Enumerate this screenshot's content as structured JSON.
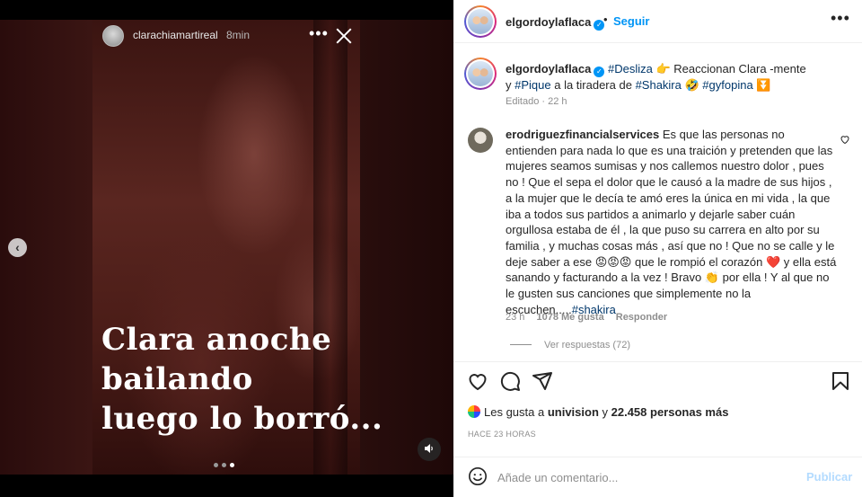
{
  "story": {
    "username": "clarachiamartireal",
    "time": "8min",
    "more_label": "•••",
    "caption_lines": [
      "Clara anoche",
      "bailando",
      "luego lo borró..."
    ],
    "dots_total": 3,
    "dots_active_index": 2
  },
  "post": {
    "account": "elgordoylaflaca",
    "follow_label": "Seguir",
    "header_sep": "•",
    "more_label": "•••",
    "caption": {
      "tag1": "#Desliza",
      "emoji1": "👉",
      "text1": " Reaccionan Clara -mente y ",
      "tag2": "#Pique",
      "text2": " a la tiradera de ",
      "tag3": "#Shakira",
      "emoji2": " 🤣 ",
      "tag4": "#gyfopina",
      "emoji3": " ⏬"
    },
    "caption_meta": "Editado · 22 h"
  },
  "comment": {
    "username": "erodriguezfinancialservices",
    "text_before_emojis": "Es que las personas no entienden para nada lo que es una traición y pretenden que las mujeres seamos sumisas y nos callemos nuestro dolor , pues no ! Que el sepa el dolor que le causó a la madre de sus hijos , a la mujer que le decía te amó eres la única en mi vida , la que iba a todos sus partidos a animarlo y dejarle saber cuán orgullosa estaba de él , la que puso su carrera en alto por su familia , y muchas cosas más , así que no ! Que no se calle y le deje saber a ese ",
    "emojis_angry": "😡😡😡",
    "text_mid": " que le rompió el corazón ",
    "emoji_heart": "❤️",
    "text_mid2": " y ella está sanando y facturando a la vez ! Bravo ",
    "emoji_clap": "👏",
    "text_end": " por ella ! Y al que no le gusten sus canciones que simplemente no la escuchen.....",
    "tag": "#shakira",
    "time": "23 h",
    "likes": "1078 Me gusta",
    "reply_label": "Responder",
    "view_replies": "Ver respuestas (72)"
  },
  "likes_line": {
    "prefix": "Les gusta a ",
    "liker": "univision",
    "middle": " y ",
    "others": "22.458 personas más"
  },
  "timeago": "HACE 23 HORAS",
  "comment_box": {
    "placeholder": "Añade un comentario...",
    "publish_label": "Publicar"
  },
  "icons": [
    "story-avatar",
    "close-icon",
    "sound-icon",
    "chevron-left-icon",
    "verified-icon",
    "heart-icon",
    "comment-icon",
    "share-icon",
    "bookmark-icon",
    "emoji-icon"
  ],
  "colors": {
    "link": "#0095f6",
    "hashtag": "#00376b",
    "muted": "#8e8e8e",
    "publish_disabled": "#b3dbff"
  }
}
